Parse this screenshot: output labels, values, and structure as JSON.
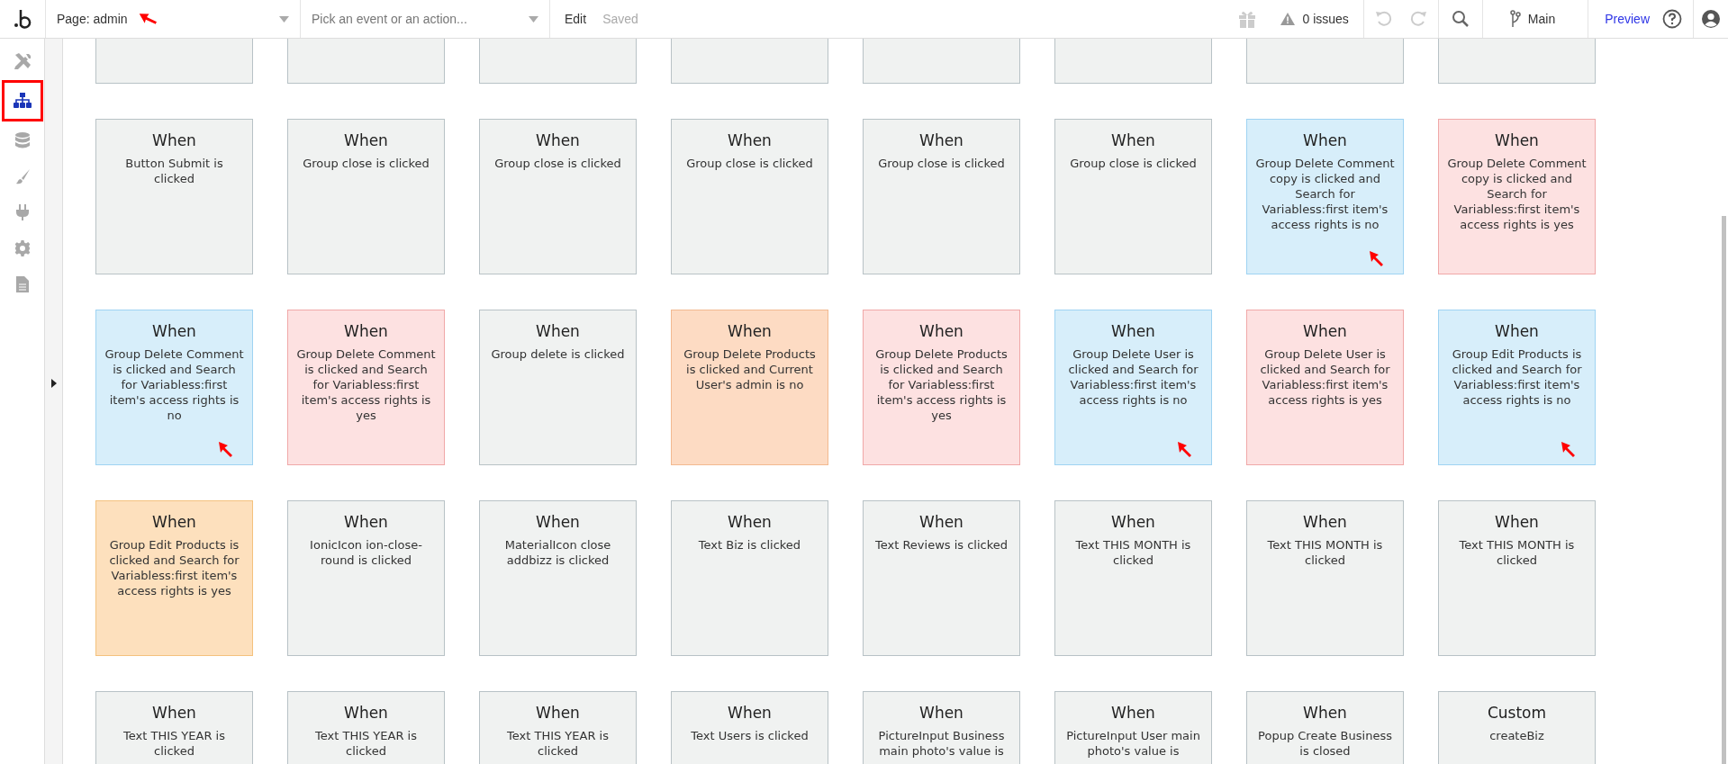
{
  "topbar": {
    "page_selector": {
      "label": "Page: admin",
      "marked": true
    },
    "event_selector": {
      "placeholder": "Pick an event or an action..."
    },
    "edit": "Edit",
    "save_status": "Saved",
    "issues": "0 issues",
    "branch": "Main",
    "preview": "Preview"
  },
  "sidebar": {
    "items": [
      {
        "kind": "design",
        "selected": false,
        "marked": false
      },
      {
        "kind": "workflow",
        "selected": true,
        "marked": true
      },
      {
        "kind": "data",
        "selected": false,
        "marked": false
      },
      {
        "kind": "styles",
        "selected": false,
        "marked": false
      },
      {
        "kind": "plugins",
        "selected": false,
        "marked": false
      },
      {
        "kind": "settings",
        "selected": false,
        "marked": false
      },
      {
        "kind": "logs",
        "selected": false,
        "marked": false
      }
    ]
  },
  "cards": [
    {
      "kind": "partial",
      "color": "#f0f2f1"
    },
    {
      "kind": "partial",
      "color": "#f0f2f1"
    },
    {
      "kind": "partial",
      "color": "#f0f2f1"
    },
    {
      "kind": "partial",
      "color": "#f0f2f1"
    },
    {
      "kind": "partial",
      "color": "#f0f2f1"
    },
    {
      "kind": "partial",
      "color": "#f0f2f1"
    },
    {
      "kind": "partial",
      "color": "#f0f2f1"
    },
    {
      "kind": "partial",
      "color": "#f0f2f1"
    },
    {
      "kind": "full",
      "color": "#f0f2f1",
      "title": "When",
      "text": "Button Submit is clicked",
      "marked": false
    },
    {
      "kind": "full",
      "color": "#f0f2f1",
      "title": "When",
      "text": "Group close is clicked",
      "marked": false
    },
    {
      "kind": "full",
      "color": "#f0f2f1",
      "title": "When",
      "text": "Group close is clicked",
      "marked": false
    },
    {
      "kind": "full",
      "color": "#f0f2f1",
      "title": "When",
      "text": "Group close is clicked",
      "marked": false
    },
    {
      "kind": "full",
      "color": "#f0f2f1",
      "title": "When",
      "text": "Group close is clicked",
      "marked": false
    },
    {
      "kind": "full",
      "color": "#f0f2f1",
      "title": "When",
      "text": "Group close is clicked",
      "marked": false
    },
    {
      "kind": "full",
      "color": "#d7eefa",
      "title": "When",
      "text": "Group Delete Comment copy is clicked and Search for Variabless:first item's access rights is no",
      "marked": true
    },
    {
      "kind": "full",
      "color": "#fde1e1",
      "title": "When",
      "text": "Group Delete Comment copy is clicked and Search for Variabless:first item's access rights is yes",
      "marked": false
    },
    {
      "kind": "full",
      "color": "#d7eefa",
      "title": "When",
      "text": "Group Delete Comment is clicked and Search for Variabless:first item's access rights is no",
      "marked": true
    },
    {
      "kind": "full",
      "color": "#fde1e1",
      "title": "When",
      "text": "Group Delete Comment is clicked and Search for Variabless:first item's access rights is yes",
      "marked": false
    },
    {
      "kind": "full",
      "color": "#f0f2f1",
      "title": "When",
      "text": "Group delete is clicked",
      "marked": false
    },
    {
      "kind": "full",
      "color": "#fddbc3",
      "title": "When",
      "text": "Group Delete Products is clicked and Current User's admin is no",
      "marked": false
    },
    {
      "kind": "full",
      "color": "#fde1e1",
      "title": "When",
      "text": "Group Delete Products is clicked and Search for Variabless:first item's access rights is yes",
      "marked": false
    },
    {
      "kind": "full",
      "color": "#d7eefa",
      "title": "When",
      "text": "Group Delete User is clicked and Search for Variabless:first item's access rights is no",
      "marked": true
    },
    {
      "kind": "full",
      "color": "#fde1e1",
      "title": "When",
      "text": "Group Delete User is clicked and Search for Variabless:first item's access rights is yes",
      "marked": false
    },
    {
      "kind": "full",
      "color": "#d7eefa",
      "title": "When",
      "text": "Group Edit Products is clicked and Search for Variabless:first item's access rights is no",
      "marked": true
    },
    {
      "kind": "full",
      "color": "#fde0bd",
      "title": "When",
      "text": "Group Edit Products is clicked and Search for Variabless:first item's access rights is yes",
      "marked": false
    },
    {
      "kind": "full",
      "color": "#f0f2f1",
      "title": "When",
      "text": "IonicIcon ion-close-round is clicked",
      "marked": false
    },
    {
      "kind": "full",
      "color": "#f0f2f1",
      "title": "When",
      "text": "MaterialIcon close addbizz is clicked",
      "marked": false
    },
    {
      "kind": "full",
      "color": "#f0f2f1",
      "title": "When",
      "text": "Text Biz is clicked",
      "marked": false
    },
    {
      "kind": "full",
      "color": "#f0f2f1",
      "title": "When",
      "text": "Text Reviews is clicked",
      "marked": false
    },
    {
      "kind": "full",
      "color": "#f0f2f1",
      "title": "When",
      "text": "Text THIS MONTH is clicked",
      "marked": false
    },
    {
      "kind": "full",
      "color": "#f0f2f1",
      "title": "When",
      "text": "Text THIS MONTH is clicked",
      "marked": false
    },
    {
      "kind": "full",
      "color": "#f0f2f1",
      "title": "When",
      "text": "Text THIS MONTH is clicked",
      "marked": false
    },
    {
      "kind": "full",
      "color": "#f0f2f1",
      "title": "When",
      "text": "Text THIS YEAR is clicked",
      "marked": false
    },
    {
      "kind": "full",
      "color": "#f0f2f1",
      "title": "When",
      "text": "Text THIS YEAR is clicked",
      "marked": false
    },
    {
      "kind": "full",
      "color": "#f0f2f1",
      "title": "When",
      "text": "Text THIS YEAR is clicked",
      "marked": false
    },
    {
      "kind": "full",
      "color": "#f0f2f1",
      "title": "When",
      "text": "Text Users is clicked",
      "marked": false
    },
    {
      "kind": "full",
      "color": "#f0f2f1",
      "title": "When",
      "text": "PictureInput Business main photo's value is",
      "marked": false
    },
    {
      "kind": "full",
      "color": "#f0f2f1",
      "title": "When",
      "text": "PictureInput User main photo's value is",
      "marked": false
    },
    {
      "kind": "full",
      "color": "#f0f2f1",
      "title": "When",
      "text": "Popup Create Business is closed",
      "marked": false
    },
    {
      "kind": "full",
      "color": "#f0f2f1",
      "title": "Custom",
      "text": "createBiz",
      "marked": false
    }
  ]
}
